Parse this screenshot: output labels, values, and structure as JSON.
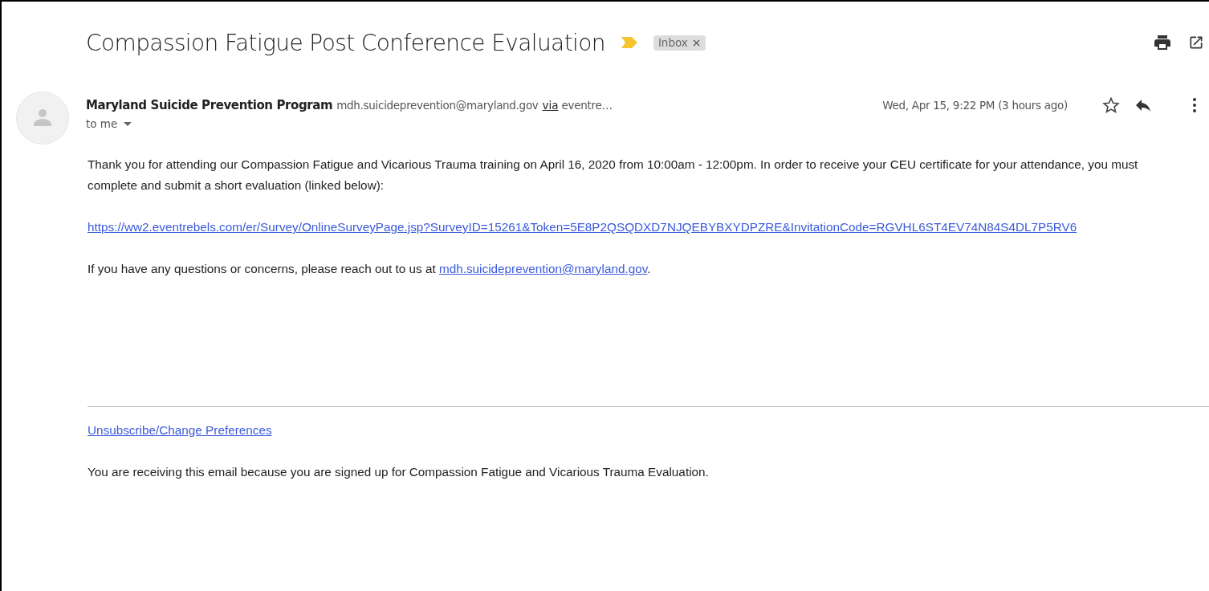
{
  "subject": "Compassion Fatigue Post Conference Evaluation",
  "important": true,
  "labels": [
    {
      "text": "Inbox",
      "remove": "×"
    }
  ],
  "sender": {
    "name": "Maryland Suicide Prevention Program",
    "email": "mdh.suicideprevention@maryland.gov",
    "via": "via",
    "via_domain": "eventre…",
    "date": "Wed, Apr 15, 9:22 PM (3 hours ago)",
    "starred": false,
    "recipient": "to me"
  },
  "body": [
    {
      "kind": "text",
      "text": "Thank you for attending our Compassion Fatigue and Vicarious Trauma training on April 16, 2020 from 10:00am - 12:00pm. In order to receive your CEU certificate for your attendance, you must complete and submit a short evaluation (linked below):"
    },
    {
      "kind": "link",
      "text": "https://ww2.eventrebels.com/er/Survey/OnlineSurveyPage.jsp?SurveyID=15261&Token=5E8P2QSQDXD7NJQEBYBXYDPZRE&InvitationCode=RGVHL6ST4EV74N84S4DL7P5RV6"
    },
    {
      "kind": "text_link",
      "text": "If you have any questions or concerns, please reach out to us at ",
      "link": "mdh.suicideprevention@maryland.gov",
      "after": "."
    }
  ],
  "footer": {
    "link": "Unsubscribe/Change Preferences",
    "note": "You are receiving this email because you are signed up for Compassion Fatigue and Vicarious Trauma Evaluation."
  }
}
